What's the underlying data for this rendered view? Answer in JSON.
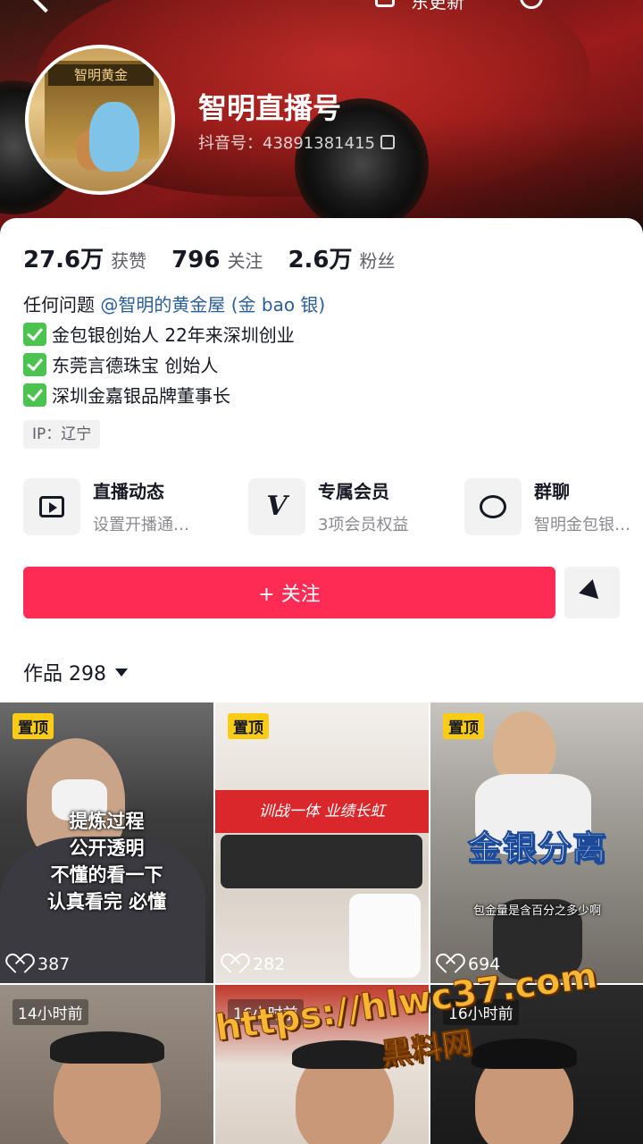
{
  "header": {
    "update_label": "东更新",
    "nickname": "智明直播号",
    "douyin_id": "抖音号：43891381415",
    "avatar_sign": "智明黄金"
  },
  "stats": [
    {
      "num": "27.6万",
      "label": "获赞"
    },
    {
      "num": "796",
      "label": "关注"
    },
    {
      "num": "2.6万",
      "label": "粉丝"
    }
  ],
  "bio": {
    "line1_prefix": "任何问题 ",
    "line1_mention": "@智明的黄金屋 (金 bao 银)",
    "line2": "金包银创始人 22年来深圳创业",
    "line3": "东莞言德珠宝  创始人",
    "line4": "深圳金嘉银品牌董事长"
  },
  "ip_tag": "IP：辽宁",
  "features": [
    {
      "title": "直播动态",
      "sub": "设置开播通…",
      "icon": "tv-icon"
    },
    {
      "title": "专属会员",
      "sub": "3项会员权益",
      "icon": "vip-v-icon"
    },
    {
      "title": "群聊",
      "sub": "智明金包银…",
      "icon": "chat-icon"
    }
  ],
  "follow_label": "+ 关注",
  "works": {
    "label": "作品 298"
  },
  "videos": [
    {
      "tag": "置顶",
      "likes": "387",
      "overlay": [
        "提炼过程",
        "公开透明",
        "不懂的看一下",
        "认真看完 必懂"
      ]
    },
    {
      "tag": "置顶",
      "likes": "282",
      "banner": "训战一体 业绩长虹"
    },
    {
      "tag": "置顶",
      "likes": "694",
      "overlay_big": "金银分离",
      "overlay_small": "包金量是含百分之多少啊"
    },
    {
      "time": "14小时前"
    },
    {
      "time": "16小时前"
    },
    {
      "time": "16小时前"
    }
  ],
  "watermark": {
    "url": "https://hlwc37.com",
    "name": "黑料网"
  },
  "colors": {
    "accent": "#fe2c55",
    "pin": "#facc15",
    "mention": "#2a5d9c",
    "check": "#4bc44f"
  }
}
